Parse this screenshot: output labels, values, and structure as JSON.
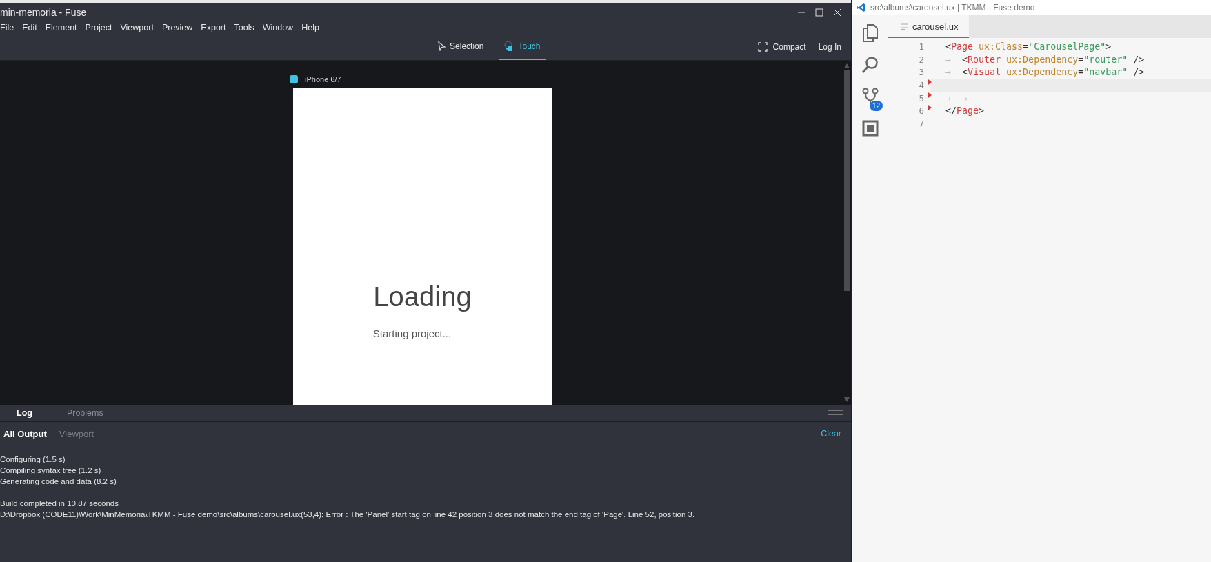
{
  "fuse_window": {
    "title": "min-memoria - Fuse",
    "menu": [
      "File",
      "Edit",
      "Element",
      "Project",
      "Viewport",
      "Preview",
      "Export",
      "Tools",
      "Window",
      "Help"
    ],
    "modes": [
      {
        "label": "Selection",
        "kind": "pointer",
        "selected": false
      },
      {
        "label": "Touch",
        "kind": "touch",
        "selected": true
      }
    ],
    "right_actions": [
      {
        "label": "Compact",
        "kind": "compact"
      },
      {
        "label": "Log In",
        "kind": "plain"
      }
    ],
    "device": {
      "label": "iPhone 6/7"
    },
    "preview": {
      "heading": "Loading",
      "status": "Starting project..."
    },
    "panel_tabs": [
      {
        "label": "Log",
        "selected": true
      },
      {
        "label": "Problems",
        "selected": false
      }
    ],
    "output_tabs": [
      {
        "label": "All Output",
        "selected": true
      },
      {
        "label": "Viewport",
        "selected": false
      }
    ],
    "clear": "Clear",
    "log_blocks": [
      [
        "Configuring (1.5 s)",
        "Compiling syntax tree (1.2 s)",
        "Generating code and data (8.2 s)"
      ],
      [
        "Build completed in 10.87 seconds",
        "D:\\Dropbox (CODE11)\\Work\\MinMemoria\\TKMM - Fuse demo\\src\\albums\\carousel.ux(53,4): Error : The 'Panel' start tag on line 42 position 3 does not match the end tag of 'Page'. Line 52, position 3."
      ]
    ]
  },
  "editor_window": {
    "title": "src\\albums\\carousel.ux | TKMM - Fuse demo",
    "activity": [
      {
        "kind": "files"
      },
      {
        "kind": "search"
      },
      {
        "kind": "source-control",
        "badge": "12"
      },
      {
        "kind": "extensions"
      }
    ],
    "tab": {
      "label": "carousel.ux"
    },
    "lines": [
      {
        "number": "1",
        "current": false,
        "marked": false,
        "tokens": [
          {
            "kind": "punct",
            "text": "<"
          },
          {
            "kind": "tag",
            "text": "Page"
          },
          {
            "kind": "attr",
            "text": " ux:Class"
          },
          {
            "kind": "punct",
            "text": "="
          },
          {
            "kind": "string",
            "text": "\"CarouselPage\""
          },
          {
            "kind": "punct",
            "text": ">"
          }
        ]
      },
      {
        "number": "2",
        "current": false,
        "marked": false,
        "tokens": [
          {
            "kind": "guide",
            "text": "→"
          },
          {
            "kind": "punct",
            "text": "  <"
          },
          {
            "kind": "tag",
            "text": "Router"
          },
          {
            "kind": "attr",
            "text": " ux:Dependency"
          },
          {
            "kind": "punct",
            "text": "="
          },
          {
            "kind": "string",
            "text": "\"router\""
          },
          {
            "kind": "punct",
            "text": " />"
          }
        ]
      },
      {
        "number": "3",
        "current": false,
        "marked": false,
        "tokens": [
          {
            "kind": "guide",
            "text": "→"
          },
          {
            "kind": "punct",
            "text": "  <"
          },
          {
            "kind": "tag",
            "text": "Visual"
          },
          {
            "kind": "attr",
            "text": " ux:Dependency"
          },
          {
            "kind": "punct",
            "text": "="
          },
          {
            "kind": "string",
            "text": "\"navbar\""
          },
          {
            "kind": "punct",
            "text": " />"
          }
        ]
      },
      {
        "number": "4",
        "current": true,
        "marked": true
      },
      {
        "number": "5",
        "current": false,
        "marked": true,
        "tokens": [
          {
            "kind": "guide",
            "text": "→  →"
          }
        ]
      },
      {
        "number": "6",
        "current": false,
        "marked": true,
        "tokens": [
          {
            "kind": "punct",
            "text": "</"
          },
          {
            "kind": "tag",
            "text": "Page"
          },
          {
            "kind": "punct",
            "text": ">"
          }
        ]
      },
      {
        "number": "7",
        "current": false,
        "marked": false
      }
    ]
  }
}
